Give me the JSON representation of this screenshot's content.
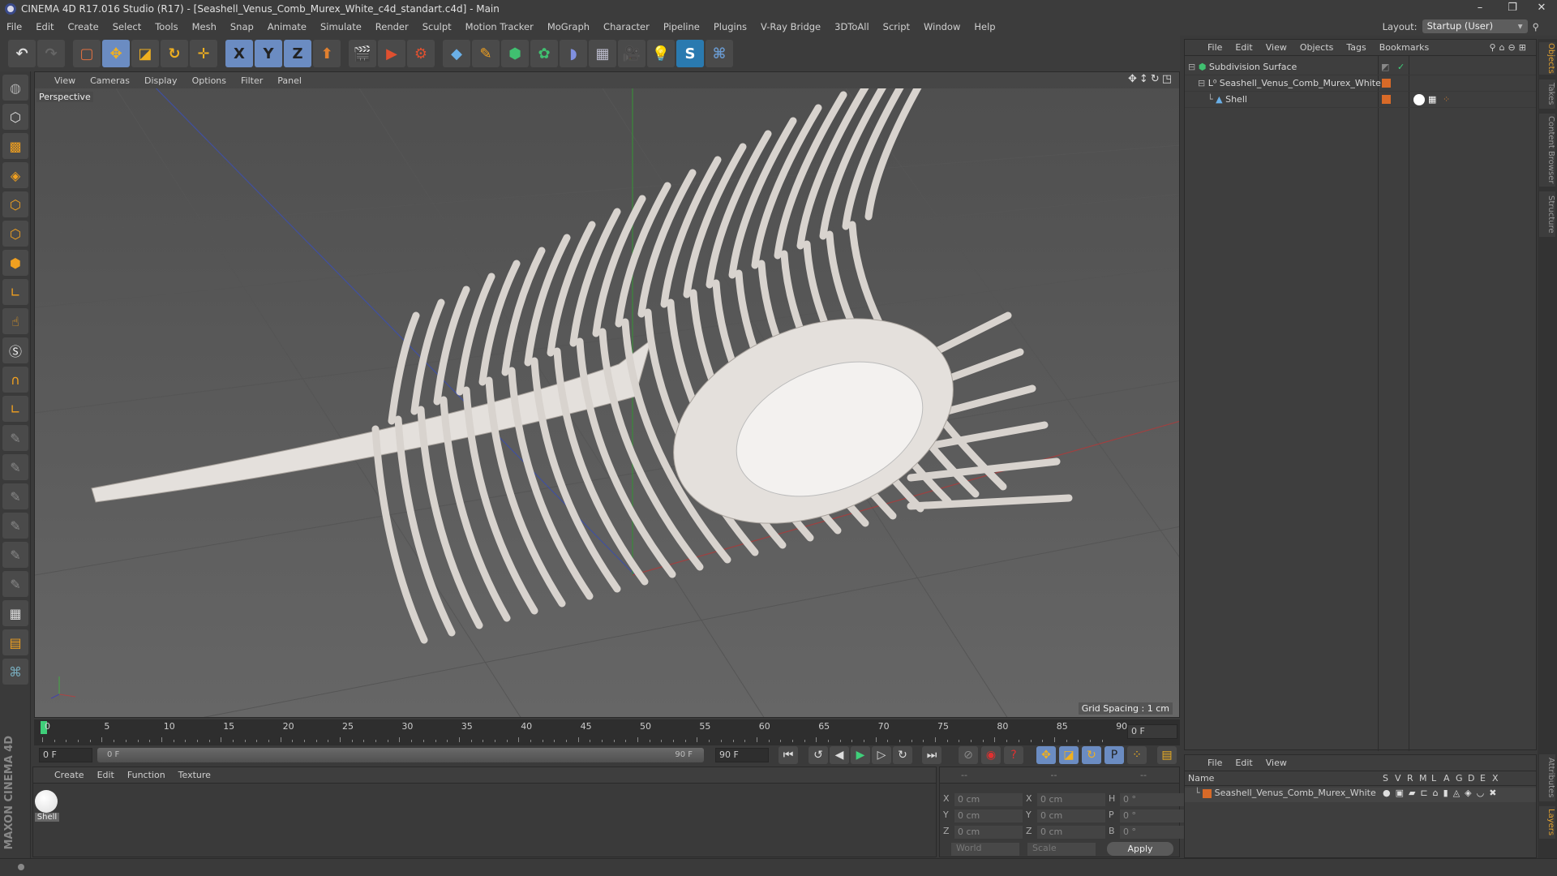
{
  "title": "CINEMA 4D R17.016 Studio (R17) - [Seashell_Venus_Comb_Murex_White_c4d_standart.c4d] - Main",
  "menu": [
    "File",
    "Edit",
    "Create",
    "Select",
    "Tools",
    "Mesh",
    "Snap",
    "Animate",
    "Simulate",
    "Render",
    "Sculpt",
    "Motion Tracker",
    "MoGraph",
    "Character",
    "Pipeline",
    "Plugins",
    "V-Ray Bridge",
    "3DToAll",
    "Script",
    "Window",
    "Help"
  ],
  "layout": {
    "label": "Layout:",
    "value": "Startup (User)"
  },
  "toolbar": {
    "x": "X",
    "y": "Y",
    "z": "Z"
  },
  "viewport": {
    "menu": [
      "View",
      "Cameras",
      "Display",
      "Options",
      "Filter",
      "Panel"
    ],
    "camera": "Perspective",
    "grid_spacing": "Grid Spacing : 1 cm"
  },
  "timeline": {
    "ticks": [
      "0",
      "5",
      "10",
      "15",
      "20",
      "25",
      "30",
      "35",
      "40",
      "45",
      "50",
      "55",
      "60",
      "65",
      "70",
      "75",
      "80",
      "85",
      "90"
    ],
    "current": "0 F",
    "start": "0 F",
    "range_start": "0 F",
    "range_end": "90 F",
    "end": "90 F"
  },
  "material": {
    "menu": [
      "Create",
      "Edit",
      "Function",
      "Texture"
    ],
    "items": [
      {
        "name": "Shell"
      }
    ]
  },
  "coords": {
    "headers": [
      "--",
      "--",
      "--"
    ],
    "rows": [
      [
        "X",
        "0 cm",
        "X",
        "0 cm",
        "H",
        "0 °"
      ],
      [
        "Y",
        "0 cm",
        "Y",
        "0 cm",
        "P",
        "0 °"
      ],
      [
        "Z",
        "0 cm",
        "Z",
        "0 cm",
        "B",
        "0 °"
      ]
    ],
    "mode1": "World",
    "mode2": "Scale",
    "apply": "Apply"
  },
  "objects": {
    "menu": [
      "File",
      "Edit",
      "View",
      "Objects",
      "Tags",
      "Bookmarks"
    ],
    "items": [
      {
        "name": "Subdivision Surface"
      },
      {
        "name": "Seashell_Venus_Comb_Murex_White"
      },
      {
        "name": "Shell"
      }
    ]
  },
  "layers": {
    "menu": [
      "File",
      "Edit",
      "View"
    ],
    "name_header": "Name",
    "cols": [
      "S",
      "V",
      "R",
      "M",
      "L",
      "A",
      "G",
      "D",
      "E",
      "X"
    ],
    "items": [
      {
        "name": "Seashell_Venus_Comb_Murex_White"
      }
    ]
  },
  "side_tabs": [
    "Objects",
    "Takes",
    "Content Browser",
    "Structure",
    "Attributes",
    "Layers"
  ],
  "brand": "MAXON CINEMA 4D",
  "colors": {
    "accent": "#6b8cc2",
    "layer": "#d86a28"
  }
}
